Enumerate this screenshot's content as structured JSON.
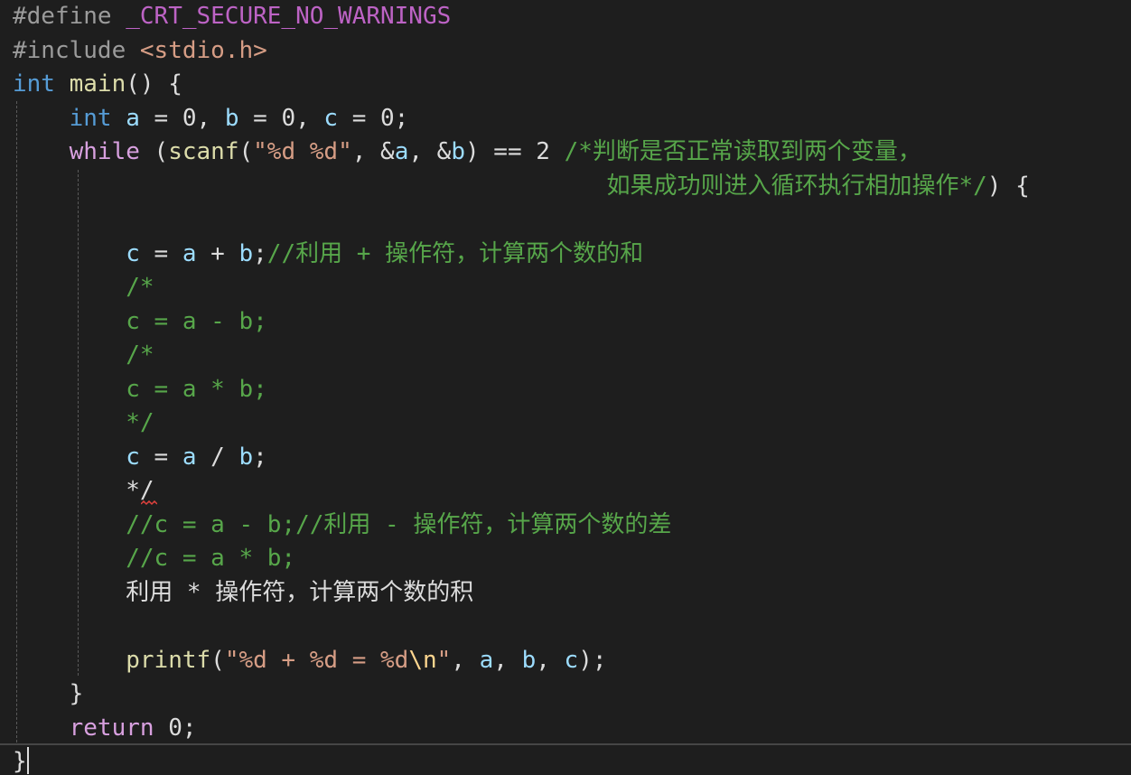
{
  "editor": {
    "language": "C",
    "colors": {
      "background": "#1e1e1e",
      "keyword": "#569cd6",
      "control": "#d8a0df",
      "preprocessor": "#9b9b9b",
      "macro": "#bd63c5",
      "string": "#d69d85",
      "comment": "#57a64a",
      "identifier": "#9cdcfe",
      "function": "#dcdcaa",
      "text": "#dcdcdc"
    },
    "lines": [
      [
        {
          "t": "#define ",
          "c": "pp"
        },
        {
          "t": "_CRT_SECURE_NO_WARNINGS",
          "c": "macro"
        }
      ],
      [
        {
          "t": "#include ",
          "c": "pp"
        },
        {
          "t": "<stdio.h>",
          "c": "str"
        }
      ],
      [
        {
          "t": "int",
          "c": "kw"
        },
        {
          "t": " ",
          "c": "plain"
        },
        {
          "t": "main",
          "c": "fn"
        },
        {
          "t": "() {",
          "c": "plain"
        }
      ],
      [
        {
          "t": "    ",
          "c": "plain"
        },
        {
          "t": "int",
          "c": "kw"
        },
        {
          "t": " ",
          "c": "plain"
        },
        {
          "t": "a",
          "c": "id"
        },
        {
          "t": " = 0, ",
          "c": "plain"
        },
        {
          "t": "b",
          "c": "id"
        },
        {
          "t": " = 0, ",
          "c": "plain"
        },
        {
          "t": "c",
          "c": "id"
        },
        {
          "t": " = 0;",
          "c": "plain"
        }
      ],
      [
        {
          "t": "    ",
          "c": "plain"
        },
        {
          "t": "while",
          "c": "ctrl"
        },
        {
          "t": " (",
          "c": "plain"
        },
        {
          "t": "scanf",
          "c": "fn"
        },
        {
          "t": "(",
          "c": "plain"
        },
        {
          "t": "\"%d %d\"",
          "c": "str"
        },
        {
          "t": ", &",
          "c": "plain"
        },
        {
          "t": "a",
          "c": "id"
        },
        {
          "t": ", &",
          "c": "plain"
        },
        {
          "t": "b",
          "c": "id"
        },
        {
          "t": ") == 2 ",
          "c": "plain"
        },
        {
          "t": "/*判断是否正常读取到两个变量，",
          "c": "cm"
        }
      ],
      [
        {
          "t": "                                          ",
          "c": "plain"
        },
        {
          "t": "如果成功则进入循环执行相加操作*/",
          "c": "cm"
        },
        {
          "t": ") {",
          "c": "plain"
        }
      ],
      [],
      [
        {
          "t": "        ",
          "c": "plain"
        },
        {
          "t": "c",
          "c": "id"
        },
        {
          "t": " = ",
          "c": "plain"
        },
        {
          "t": "a",
          "c": "id"
        },
        {
          "t": " + ",
          "c": "plain"
        },
        {
          "t": "b",
          "c": "id"
        },
        {
          "t": ";",
          "c": "plain"
        },
        {
          "t": "//利用 + 操作符，计算两个数的和",
          "c": "cm"
        }
      ],
      [
        {
          "t": "        ",
          "c": "plain"
        },
        {
          "t": "/*",
          "c": "cm"
        }
      ],
      [
        {
          "t": "        ",
          "c": "plain"
        },
        {
          "t": "c = a - b;",
          "c": "cm"
        }
      ],
      [
        {
          "t": "        ",
          "c": "plain"
        },
        {
          "t": "/*",
          "c": "cm"
        }
      ],
      [
        {
          "t": "        ",
          "c": "plain"
        },
        {
          "t": "c = a * b;",
          "c": "cm"
        }
      ],
      [
        {
          "t": "        ",
          "c": "plain"
        },
        {
          "t": "*/",
          "c": "cm"
        }
      ],
      [
        {
          "t": "        ",
          "c": "plain"
        },
        {
          "t": "c",
          "c": "id"
        },
        {
          "t": " = ",
          "c": "plain"
        },
        {
          "t": "a",
          "c": "id"
        },
        {
          "t": " / ",
          "c": "plain"
        },
        {
          "t": "b",
          "c": "id"
        },
        {
          "t": ";",
          "c": "plain"
        }
      ],
      [
        {
          "t": "        ",
          "c": "plain"
        },
        {
          "t": "*/",
          "c": "plain"
        }
      ],
      [
        {
          "t": "        ",
          "c": "plain"
        },
        {
          "t": "//c = a - b;//利用 - 操作符，计算两个数的差",
          "c": "cm"
        }
      ],
      [
        {
          "t": "        ",
          "c": "plain"
        },
        {
          "t": "//c = a * b;",
          "c": "cm"
        }
      ],
      [
        {
          "t": "        ",
          "c": "plain"
        },
        {
          "t": "利用 * 操作符，计算两个数的积",
          "c": "plain"
        }
      ],
      [],
      [
        {
          "t": "        ",
          "c": "plain"
        },
        {
          "t": "printf",
          "c": "fn"
        },
        {
          "t": "(",
          "c": "plain"
        },
        {
          "t": "\"%d + %d = %d",
          "c": "str"
        },
        {
          "t": "\\n",
          "c": "esc"
        },
        {
          "t": "\"",
          "c": "str"
        },
        {
          "t": ", ",
          "c": "plain"
        },
        {
          "t": "a",
          "c": "id"
        },
        {
          "t": ", ",
          "c": "plain"
        },
        {
          "t": "b",
          "c": "id"
        },
        {
          "t": ", ",
          "c": "plain"
        },
        {
          "t": "c",
          "c": "id"
        },
        {
          "t": ");",
          "c": "plain"
        }
      ],
      [
        {
          "t": "    }",
          "c": "plain"
        }
      ],
      [
        {
          "t": "    ",
          "c": "plain"
        },
        {
          "t": "return",
          "c": "ctrl"
        },
        {
          "t": " 0;",
          "c": "plain"
        }
      ],
      [
        {
          "t": "}",
          "c": "plain"
        }
      ]
    ]
  }
}
